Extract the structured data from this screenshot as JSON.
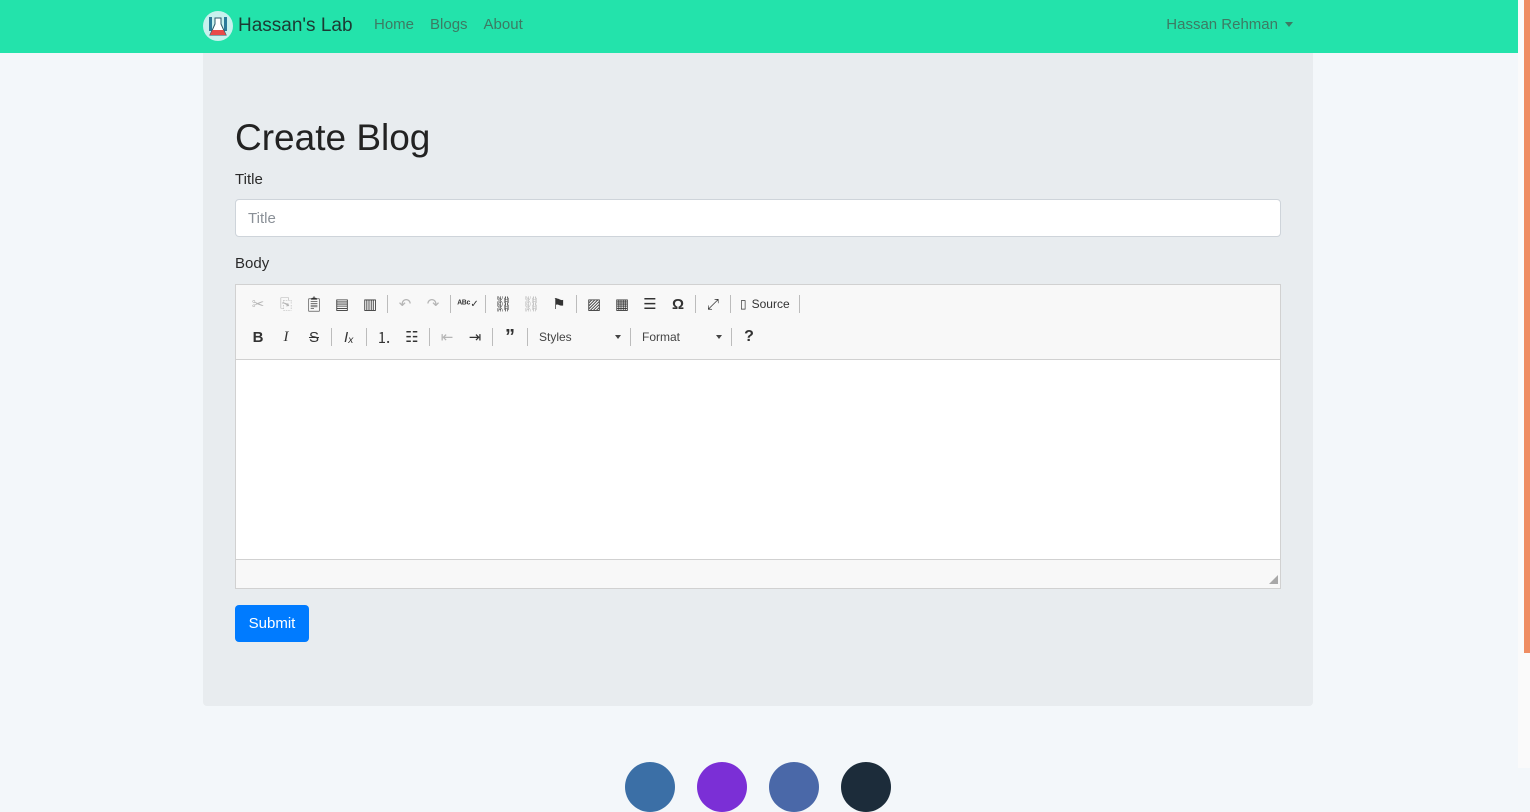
{
  "navbar": {
    "brand": "Hassan's Lab",
    "links": [
      "Home",
      "Blogs",
      "About"
    ],
    "user": "Hassan Rehman",
    "colors": {
      "background": "#23e3ab",
      "link": "#3d7a63"
    }
  },
  "main": {
    "title": "Create Blog",
    "title_label": "Title",
    "title_placeholder": "Title",
    "title_value": "",
    "body_label": "Body",
    "submit_label": "Submit"
  },
  "editor": {
    "toolbar_row1": [
      "cut-icon",
      "copy-icon",
      "paste-icon",
      "paste-text-icon",
      "paste-word-icon",
      "undo-icon",
      "redo-icon",
      "spellcheck-icon",
      "link-icon",
      "unlink-icon",
      "anchor-icon",
      "image-icon",
      "table-icon",
      "horizontal-line-icon",
      "special-char-icon",
      "maximize-icon"
    ],
    "source_label": "Source",
    "toolbar_row2": [
      "bold-icon",
      "italic-icon",
      "strikethrough-icon",
      "remove-format-icon",
      "numbered-list-icon",
      "bulleted-list-icon",
      "outdent-icon",
      "indent-icon",
      "blockquote-icon",
      "help-icon"
    ],
    "styles_label": "Styles",
    "format_label": "Format",
    "content": ""
  },
  "footer": {
    "social_colors": [
      "#3b6fa6",
      "#7b2fd6",
      "#4a68a8",
      "#1c2c3a"
    ]
  }
}
